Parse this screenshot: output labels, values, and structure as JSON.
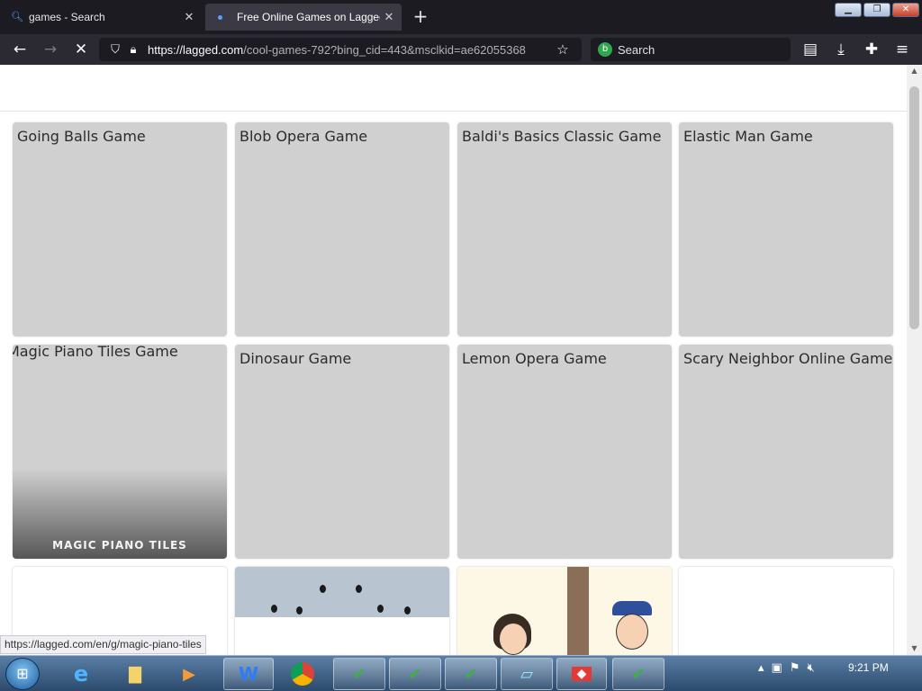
{
  "browser": {
    "tabs": [
      {
        "label": "games - Search",
        "icon": "search-icon"
      },
      {
        "label": "Free Online Games on Lagged.c",
        "icon": "loading-dot-icon"
      }
    ],
    "new_tab_label": "+",
    "url_host": "https://lagged.com",
    "url_path": "/cool-games-792?bing_cid=443&msclkid=ae62055368",
    "search_placeholder": "Search"
  },
  "page": {
    "cards": [
      {
        "title": "Going Balls Game"
      },
      {
        "title": "Blob Opera Game"
      },
      {
        "title": "Baldi's Basics Classic Game"
      },
      {
        "title": "Elastic Man Game"
      },
      {
        "title": "Magic Piano Tiles Game",
        "subtitle": "MAGIC PIANO TILES"
      },
      {
        "title": "Dinosaur Game"
      },
      {
        "title": "Lemon Opera Game"
      },
      {
        "title": "Scary Neighbor Online Game"
      }
    ],
    "status_url": "https://lagged.com/en/g/magic-piano-tiles"
  },
  "taskbar": {
    "clock": "9:21 PM"
  },
  "colors": {
    "tab_strip": "#1c1b22",
    "toolbar": "#2b2a33",
    "card_placeholder": "#d0d0d0",
    "taskbar": "#3b5e85"
  }
}
